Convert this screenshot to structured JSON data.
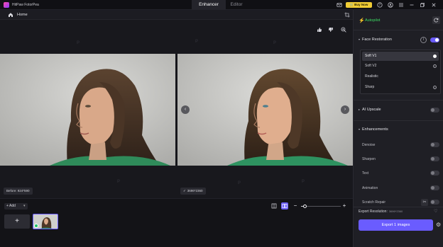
{
  "app": {
    "title": "HitPaw FotorPea"
  },
  "mode_tabs": {
    "enhancer": "Enhancer",
    "editor": "Editor"
  },
  "titlebar": {
    "buy_now": "Buy Now",
    "icons": [
      "mail-icon",
      "cart-icon",
      "help-icon",
      "account-icon",
      "menu-icon",
      "minimize-icon",
      "maximize-icon",
      "close-icon"
    ]
  },
  "breadcrumb": {
    "home": "Home"
  },
  "canvas": {
    "before_label": "Before: 924*590",
    "after_label": "3696*2360",
    "watermark": "P"
  },
  "filmstrip": {
    "add_label": "+ Add",
    "add_tile": "+"
  },
  "zoom": {
    "level": 0.1
  },
  "panel": {
    "autopilot": "Autopilot",
    "face_restoration": {
      "title": "Face Restoration",
      "enabled": true,
      "options": [
        "Soft V1",
        "Soft V2",
        "Realistic",
        "Sharp"
      ],
      "selected": "Soft V1"
    },
    "ai_upscale": {
      "title": "AI Upscale",
      "enabled": false
    },
    "enhancements": {
      "title": "Enhancements",
      "items": [
        "Denoise",
        "Sharpen",
        "Text",
        "Animation",
        "Scratch Repair"
      ]
    },
    "export_resolution": {
      "label": "Export Resolution:",
      "value": "3696*2360"
    },
    "export_button": "Export 1 images"
  },
  "colors": {
    "accent": "#6a5cff",
    "autopilot": "#3ddc63",
    "buy_now": "#f0cc35",
    "background": "#16161b"
  }
}
